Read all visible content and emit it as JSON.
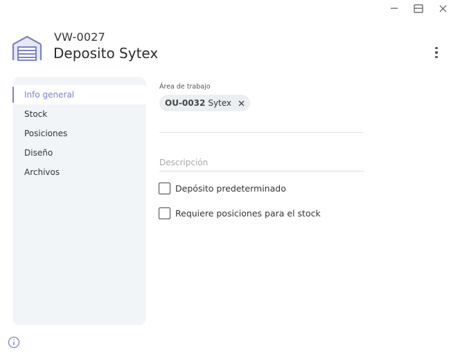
{
  "window": {
    "controls": [
      "minimize-icon",
      "maximize-icon",
      "close-icon"
    ]
  },
  "header": {
    "code": "VW-0027",
    "title": "Deposito Sytex",
    "icon": "warehouse-icon",
    "menu_icon": "kebab-menu-icon"
  },
  "sidebar": {
    "items": [
      {
        "label": "Info general",
        "active": true
      },
      {
        "label": "Stock",
        "active": false
      },
      {
        "label": "Posiciones",
        "active": false
      },
      {
        "label": "Diseño",
        "active": false
      },
      {
        "label": "Archivos",
        "active": false
      }
    ]
  },
  "main": {
    "work_area_label": "Área de trabajo",
    "chip": {
      "code": "OU-0032",
      "name": "Sytex"
    },
    "description_placeholder": "Descripción",
    "checkboxes": [
      {
        "label": "Depósito predeterminado",
        "checked": false
      },
      {
        "label": "Requiere posiciones para el stock",
        "checked": false
      }
    ]
  },
  "footer": {
    "icon": "info-icon"
  },
  "colors": {
    "accent": "#7b82c6",
    "sidebar_bg": "#f1f5f7",
    "chip_bg": "#eceff1"
  }
}
